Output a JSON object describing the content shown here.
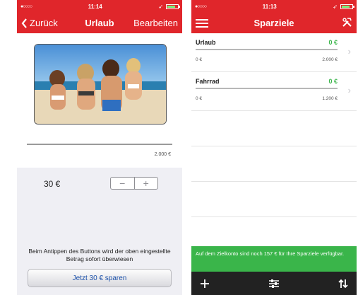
{
  "left_screen": {
    "status": {
      "carrier": "●○○○○",
      "time": "11:14"
    },
    "nav": {
      "back_label": "Zurück",
      "title": "Urlaub",
      "edit_label": "Bearbeiten"
    },
    "goal": {
      "max_amount": "2.000 €",
      "progress_fraction": 0.0
    },
    "amount": {
      "current_value": "30 €",
      "minus": "−",
      "plus": "+"
    },
    "hint_text": "Beim Antippen des Buttons wird der oben eingestellte Betrag sofort überwiesen",
    "save_button_label": "Jetzt 30 € sparen"
  },
  "right_screen": {
    "status": {
      "carrier": "●○○○○",
      "time": "11:13"
    },
    "nav": {
      "title": "Sparziele"
    },
    "goals": [
      {
        "name": "Urlaub",
        "saved": "0 €",
        "min": "0 €",
        "max": "2.000 €",
        "progress_fraction": 0.0
      },
      {
        "name": "Fahrrad",
        "saved": "0 €",
        "min": "0 €",
        "max": "1.200 €",
        "progress_fraction": 0.0
      }
    ],
    "banner_text": "Auf dem Zielkonto sind noch 157 € für Ihre Sparziele verfügbar.",
    "icons": {
      "menu": "menu-icon",
      "tools": "tools-icon",
      "add": "plus-icon",
      "filter": "sliders-icon",
      "sort": "sort-icon"
    }
  },
  "colors": {
    "brand_red": "#e0262b",
    "green": "#3ab54a",
    "tabbar": "#222222"
  }
}
